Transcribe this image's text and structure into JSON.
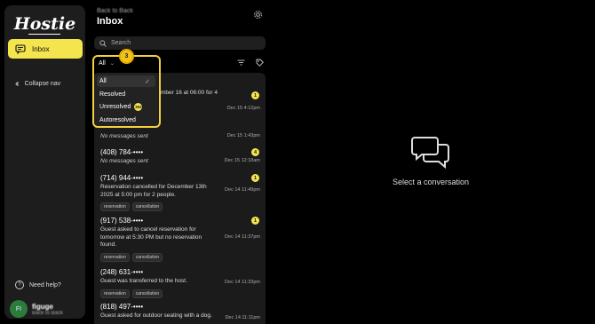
{
  "sidebar": {
    "logo": "Hostie",
    "inbox_label": "Inbox",
    "collapse_label": "Collapse nav",
    "help_label": "Need help?",
    "user": {
      "initials": "FI",
      "name": "figuge",
      "org": "Back to Back"
    }
  },
  "header": {
    "breadcrumb": "Back to Back",
    "title": "Inbox"
  },
  "search": {
    "placeholder": "Search"
  },
  "filter": {
    "selected": "All",
    "step_number": "3",
    "options": [
      {
        "label": "All",
        "checked": true
      },
      {
        "label": "Resolved"
      },
      {
        "label": "Unresolved",
        "count": "302"
      },
      {
        "label": "Autoresolved"
      }
    ]
  },
  "conversations": [
    {
      "phone": "",
      "message_tail": "mber 16 at 06:00 for 4",
      "date": "Dec 15 4:12pm",
      "badge": "1"
    },
    {
      "phone": "",
      "message": "No messages sent",
      "date": "Dec 15 1:43pm"
    },
    {
      "phone": "(408) 784-••••",
      "message": "No messages sent",
      "date": "Dec 15 12:18am",
      "badge": "4"
    },
    {
      "phone": "(714) 944-••••",
      "message": "Reservation cancelled for December 13th 2025 at 5:00 pm for 2 people.",
      "date": "Dec 14 11:49pm",
      "badge": "1",
      "tags": [
        "reservation",
        "cancellation"
      ]
    },
    {
      "phone": "(917) 538-••••",
      "message": "Guest asked to cancel reservation for tomorrow at 5:30 PM but no reservation found.",
      "date": "Dec 14 11:37pm",
      "badge": "1",
      "tags": [
        "reservation",
        "cancellation"
      ]
    },
    {
      "phone": "(248) 631-••••",
      "message": "Guest was transferred to the host.",
      "date": "Dec 14 11:33pm",
      "tags": [
        "reservation",
        "cancellation"
      ]
    },
    {
      "phone": "(818) 497-••••",
      "message": "Guest asked for outdoor seating with a dog.",
      "date": "Dec 14 11:11pm"
    }
  ],
  "empty_state": {
    "text": "Select a conversation"
  }
}
